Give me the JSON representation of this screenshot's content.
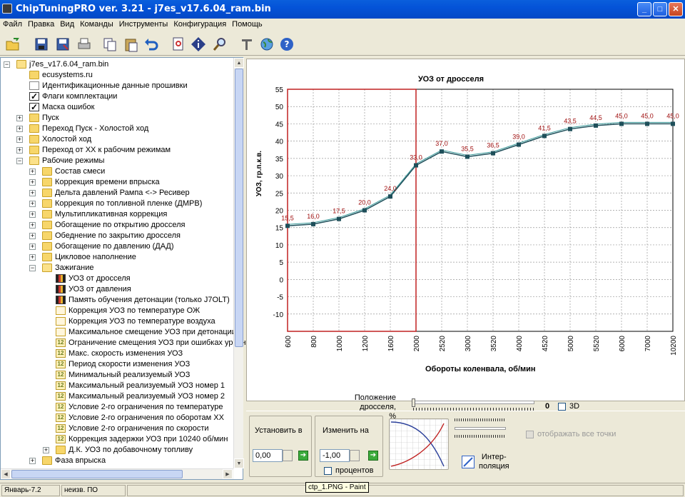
{
  "window": {
    "title": "ChipTuningPRO ver. 3.21  -  j7es_v17.6.04_ram.bin",
    "min": "_",
    "max": "□",
    "close": "✕"
  },
  "menu": [
    "Файл",
    "Правка",
    "Вид",
    "Команды",
    "Инструменты",
    "Конфигурация",
    "Помощь"
  ],
  "tree": {
    "root": "j7es_v17.6.04_ram.bin",
    "top": [
      {
        "label": "ecusystems.ru",
        "icon": "folder"
      },
      {
        "label": "Идентификационные данные прошивки",
        "icon": "doc"
      },
      {
        "label": "Флаги комплектации",
        "icon": "check"
      },
      {
        "label": "Маска ошибок",
        "icon": "check"
      },
      {
        "label": "Пуск",
        "icon": "folder",
        "exp": "+"
      },
      {
        "label": "Переход Пуск - Холостой ход",
        "icon": "folder",
        "exp": "+"
      },
      {
        "label": "Холостой ход",
        "icon": "folder",
        "exp": "+"
      },
      {
        "label": "Переход от ХХ к рабочим режимам",
        "icon": "folder",
        "exp": "+"
      },
      {
        "label": "Рабочие режимы",
        "icon": "folder-open",
        "exp": "−"
      }
    ],
    "work": [
      {
        "label": "Состав смеси",
        "exp": "+"
      },
      {
        "label": "Коррекция времени впрыска",
        "exp": "+"
      },
      {
        "label": "Дельта давлений Рампа <-> Ресивер",
        "exp": "+"
      },
      {
        "label": "Коррекция по топливной пленке (ДМРВ)",
        "exp": "+"
      },
      {
        "label": "Мультипликативная коррекция",
        "exp": "+"
      },
      {
        "label": "Обогащение по открытию дросселя",
        "exp": "+"
      },
      {
        "label": "Обеднение по закрытию дросселя",
        "exp": "+"
      },
      {
        "label": "Обогащение по давлению (ДАД)",
        "exp": "+"
      },
      {
        "label": "Цикловое наполнение",
        "exp": "+"
      },
      {
        "label": "Зажигание",
        "exp": "−"
      }
    ],
    "ignition": [
      {
        "label": "УОЗ от дросселя",
        "icon": "bar"
      },
      {
        "label": "УОЗ от давления",
        "icon": "bar"
      },
      {
        "label": "Память обучения детонации (только J7OLT)",
        "icon": "bar"
      },
      {
        "label": "Коррекция УОЗ по температуре ОЖ",
        "icon": "curve"
      },
      {
        "label": "Коррекция УОЗ по температуре воздуха",
        "icon": "curve"
      },
      {
        "label": "Максимальное смещение УОЗ при детонации",
        "icon": "curve"
      },
      {
        "label": "Ограничение смещения УОЗ при ошибках уровн",
        "icon": "n12"
      },
      {
        "label": "Макс. скорость изменения УОЗ",
        "icon": "n12"
      },
      {
        "label": "Период скорости изменения УОЗ",
        "icon": "n12"
      },
      {
        "label": "Минимальный реализуемый УОЗ",
        "icon": "n12"
      },
      {
        "label": "Максимальный реализуемый УОЗ номер 1",
        "icon": "n12"
      },
      {
        "label": "Максимальный реализуемый УОЗ номер 2",
        "icon": "n12"
      },
      {
        "label": "Условие 2-го ограничения по температуре",
        "icon": "n12"
      },
      {
        "label": "Условие 2-го ограничения по оборотам ХХ",
        "icon": "n12"
      },
      {
        "label": "Условие 2-го ограничения по скорости",
        "icon": "n12"
      },
      {
        "label": "Коррекция задержки УОЗ при 10240 об/мин",
        "icon": "n12"
      },
      {
        "label": "Д.К. УОЗ по добавочному топливу",
        "icon": "folder",
        "exp": "+"
      }
    ],
    "last": {
      "label": "Фаза впрыска",
      "exp": "+"
    }
  },
  "chart_data": {
    "type": "line",
    "title": "УОЗ от дросселя",
    "xlabel": "Обороты коленвала, об/мин",
    "ylabel": "УОЗ, гр.п.к.в.",
    "categories": [
      "600",
      "800",
      "1000",
      "1200",
      "1600",
      "2000",
      "2520",
      "3000",
      "3520",
      "4000",
      "4520",
      "5000",
      "5520",
      "6000",
      "7000",
      "10200"
    ],
    "values": [
      15.5,
      16.0,
      17.5,
      20.0,
      24.0,
      33.0,
      37.0,
      35.5,
      36.5,
      39.0,
      41.5,
      43.5,
      44.5,
      45.0,
      45.0,
      45.0
    ],
    "value_labels": [
      "15,5",
      "16,0",
      "17,5",
      "20,0",
      "24,0",
      "33,0",
      "37,0",
      "35,5",
      "36,5",
      "39,0",
      "41,5",
      "43,5",
      "44,5",
      "45,0",
      "45,0",
      "45,0"
    ],
    "yticks": [
      "55",
      "50",
      "45",
      "40",
      "35",
      "30",
      "25",
      "20",
      "15",
      "10",
      "5",
      "0",
      "-5",
      "-10"
    ],
    "ylim": [
      -15,
      55
    ],
    "grid": true,
    "selection": {
      "from": "600",
      "to": "2000"
    }
  },
  "controls": {
    "throttle_label": "Положение дросселя,\n%",
    "throttle_value": "0",
    "threeD": "3D",
    "set_label": "Установить в",
    "set_value": "0,00",
    "change_label": "Изменить на",
    "change_value": "-1,00",
    "percent": "процентов",
    "interp": "Интер-\nполяция",
    "show_all": "отображать все точки"
  },
  "status": {
    "left": "Январь-7.2",
    "mid": "неизв. ПО",
    "tooltip": "ctp_1.PNG - Paint"
  },
  "colors": {
    "series": "#1E4F5A",
    "selection": "#C02020",
    "labels": "#A01010"
  }
}
